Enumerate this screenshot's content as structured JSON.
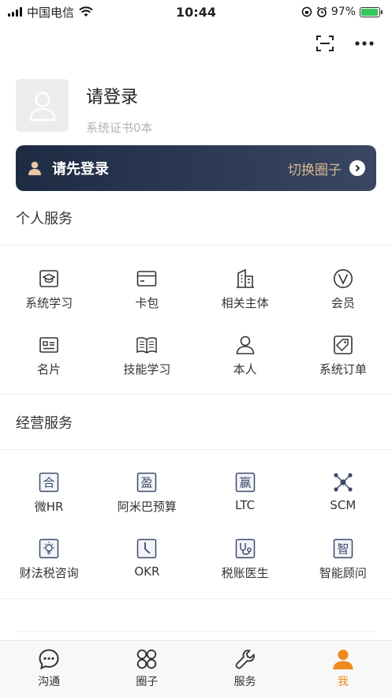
{
  "status_bar": {
    "carrier": "中国电信",
    "time": "10:44",
    "battery_percent": "97%",
    "battery_level": 0.97
  },
  "profile": {
    "title": "请登录",
    "cert_count": "系统证书0本"
  },
  "banner": {
    "prompt": "请先登录",
    "switch_label": "切换圈子"
  },
  "personal_services": {
    "title": "个人服务",
    "items": [
      {
        "label": "系统学习",
        "icon": "graduation-cap-icon"
      },
      {
        "label": "卡包",
        "icon": "wallet-icon"
      },
      {
        "label": "相关主体",
        "icon": "building-icon"
      },
      {
        "label": "会员",
        "icon": "vip-icon"
      },
      {
        "label": "名片",
        "icon": "business-card-icon"
      },
      {
        "label": "技能学习",
        "icon": "book-icon"
      },
      {
        "label": "本人",
        "icon": "person-icon"
      },
      {
        "label": "系统订单",
        "icon": "order-tag-icon"
      }
    ]
  },
  "business_services": {
    "title": "经营服务",
    "items": [
      {
        "label": "微HR",
        "icon": "he-char-icon",
        "glyph": "合"
      },
      {
        "label": "阿米巴预算",
        "icon": "ying-char-icon",
        "glyph": "盈"
      },
      {
        "label": "LTC",
        "icon": "ying-win-char-icon",
        "glyph": "赢"
      },
      {
        "label": "SCM",
        "icon": "network-icon"
      },
      {
        "label": "财法税咨询",
        "icon": "lightbulb-icon"
      },
      {
        "label": "OKR",
        "icon": "clock-icon"
      },
      {
        "label": "税账医生",
        "icon": "doctor-icon"
      },
      {
        "label": "智能顾问",
        "icon": "zhi-char-icon",
        "glyph": "智"
      }
    ]
  },
  "tabs": [
    {
      "label": "沟通",
      "icon": "chat-icon"
    },
    {
      "label": "圈子",
      "icon": "circles-icon"
    },
    {
      "label": "服务",
      "icon": "wrench-icon"
    },
    {
      "label": "我",
      "icon": "me-icon"
    }
  ],
  "colors": {
    "accent": "#f08a1c",
    "banner_dark": "#1e2b43",
    "banner_gold": "#d7b894",
    "icon_blue": "#3d4a6b"
  }
}
